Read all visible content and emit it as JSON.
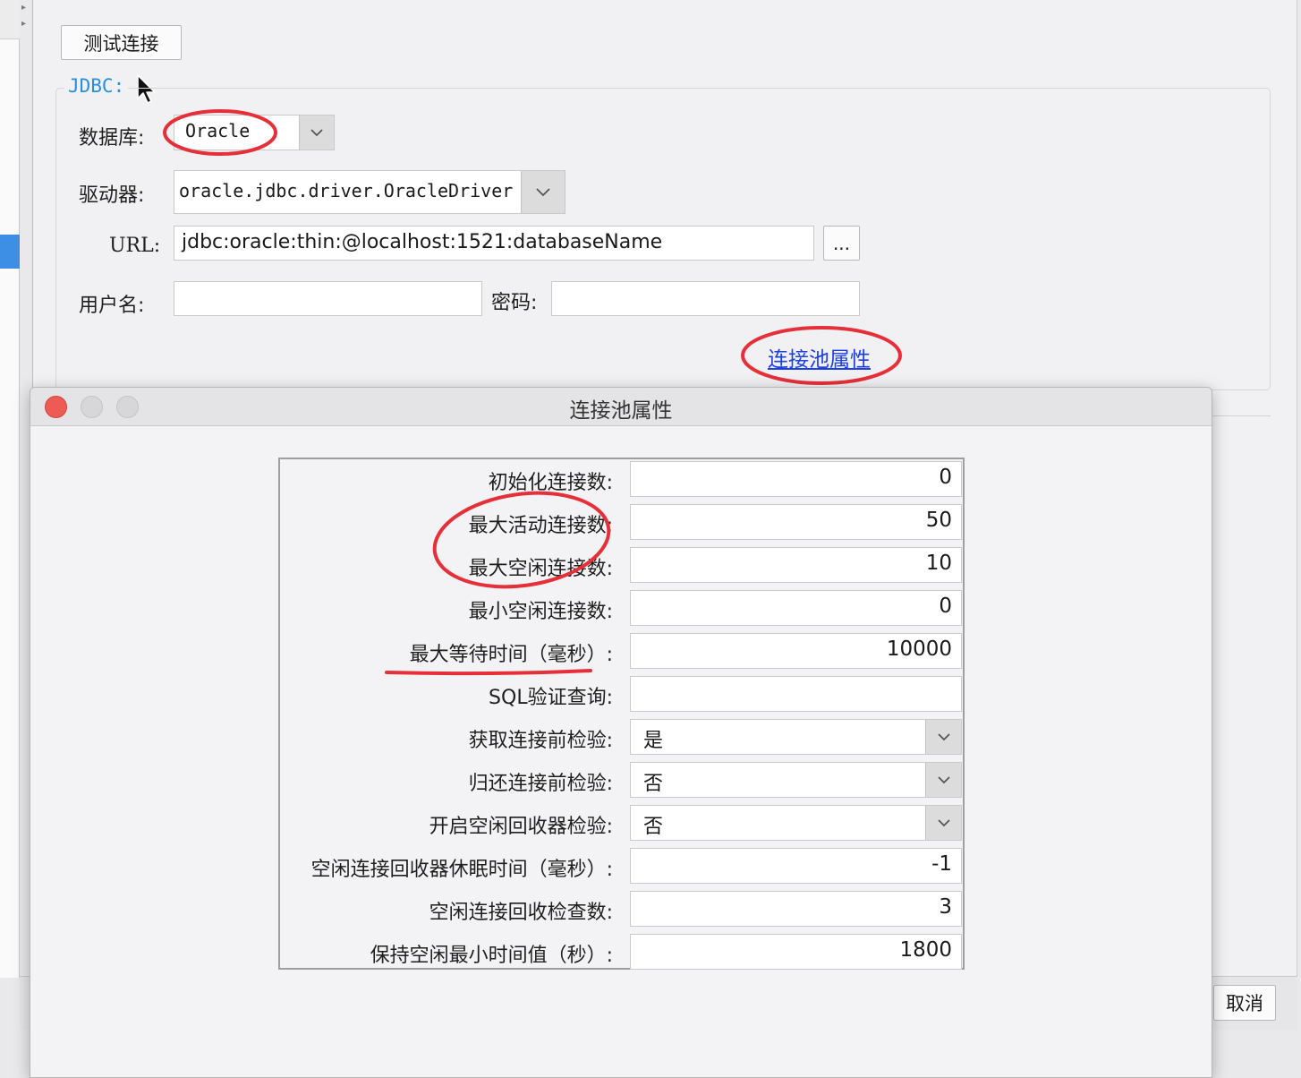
{
  "main_window": {
    "test_connection_button": "测试连接",
    "jdbc_group_title": "JDBC:",
    "database_label": "数据库:",
    "database_value": "Oracle",
    "driver_label": "驱动器:",
    "driver_value": "oracle.jdbc.driver.OracleDriver",
    "url_label": "URL:",
    "url_value": "jdbc:oracle:thin:@localhost:1521:databaseName",
    "url_browse_button": "...",
    "username_label": "用户名:",
    "username_value": "",
    "password_label": "密码:",
    "password_value": "",
    "pool_properties_link": "连接池属性",
    "cancel_button": "取消"
  },
  "dialog": {
    "title": "连接池属性",
    "rows": [
      {
        "label": "初始化连接数:",
        "value": "0",
        "kind": "text"
      },
      {
        "label": "最大活动连接数:",
        "value": "50",
        "kind": "text"
      },
      {
        "label": "最大空闲连接数:",
        "value": "10",
        "kind": "text"
      },
      {
        "label": "最小空闲连接数:",
        "value": "0",
        "kind": "text"
      },
      {
        "label": "最大等待时间（毫秒）:",
        "value": "10000",
        "kind": "text"
      },
      {
        "label": "SQL验证查询:",
        "value": "",
        "kind": "text"
      },
      {
        "label": "获取连接前检验:",
        "value": "是",
        "kind": "combo"
      },
      {
        "label": "归还连接前检验:",
        "value": "否",
        "kind": "combo"
      },
      {
        "label": "开启空闲回收器检验:",
        "value": "否",
        "kind": "combo"
      },
      {
        "label": "空闲连接回收器休眠时间（毫秒）:",
        "value": "-1",
        "kind": "text"
      },
      {
        "label": "空闲连接回收检查数:",
        "value": "3",
        "kind": "text"
      },
      {
        "label": "保持空闲最小时间值（秒）:",
        "value": "1800",
        "kind": "text"
      }
    ]
  },
  "annotation_color": "#e5303a",
  "icons": {
    "combo_arrow": "chevron-down-icon",
    "cursor": "mouse-pointer-icon"
  }
}
